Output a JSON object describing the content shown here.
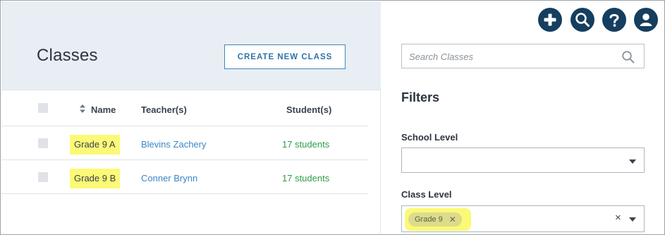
{
  "header": {
    "title": "Classes",
    "create_button": "CREATE NEW CLASS"
  },
  "table": {
    "columns": {
      "name": "Name",
      "teacher": "Teacher(s)",
      "students": "Student(s)"
    },
    "rows": [
      {
        "name": "Grade 9 A",
        "teacher": "Blevins Zachery",
        "students": "17 students"
      },
      {
        "name": "Grade 9 B",
        "teacher": "Conner Brynn",
        "students": "17 students"
      }
    ]
  },
  "toolbar": {
    "icons": [
      "plus-icon",
      "search-icon",
      "help-icon",
      "user-icon"
    ]
  },
  "search": {
    "placeholder": "Search Classes"
  },
  "filters": {
    "title": "Filters",
    "school_level_label": "School Level",
    "school_level_value": "",
    "class_level_label": "Class Level",
    "class_level_chip": "Grade 9",
    "chip_remove": "✕",
    "clear": "×"
  },
  "colors": {
    "accent": "#2f73ab",
    "dark_button": "#153e5f",
    "link": "#3a86c6",
    "students": "#2f9c48",
    "highlight": "#fbf976",
    "header_bg": "#e8eef3"
  }
}
